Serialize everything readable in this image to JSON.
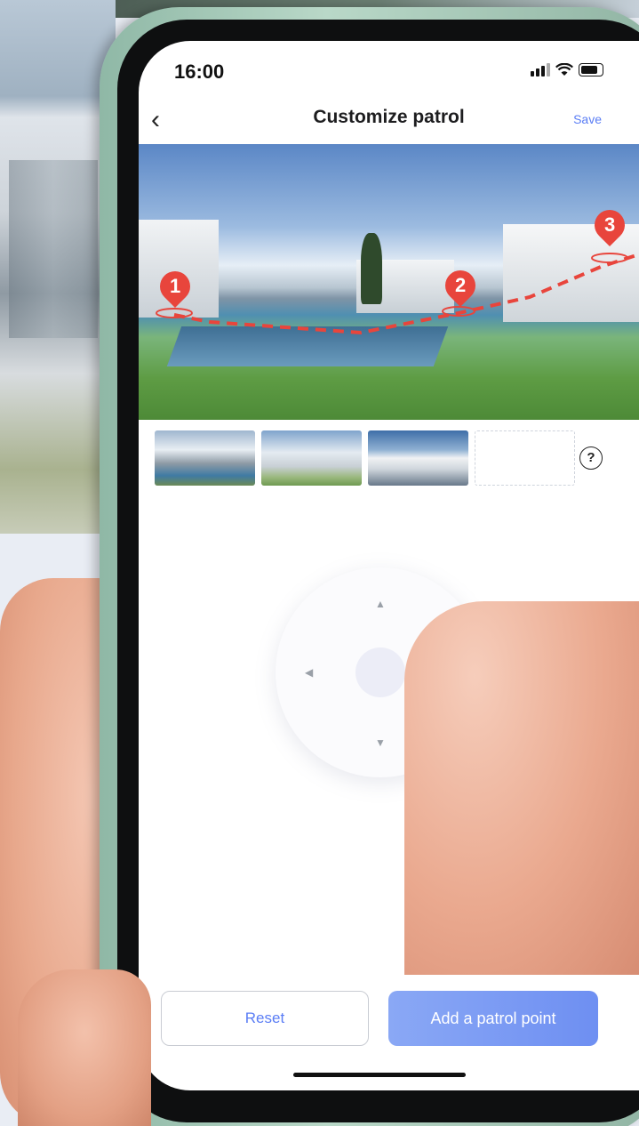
{
  "status_bar": {
    "time": "16:00"
  },
  "nav": {
    "back_icon": "chevron-left-icon",
    "title": "Customize patrol",
    "save_label": "Save"
  },
  "preview": {
    "patrol_points": [
      {
        "label": "1"
      },
      {
        "label": "2"
      },
      {
        "label": "3"
      }
    ],
    "path_color": "#e8453c"
  },
  "thumbnails": {
    "items": [
      "patrol-point-1",
      "patrol-point-2",
      "patrol-point-3",
      "empty-slot"
    ],
    "help_icon": "question-circle-icon",
    "help_glyph": "?"
  },
  "joystick": {
    "up_glyph": "▲",
    "down_glyph": "▼",
    "left_glyph": "◀"
  },
  "actions": {
    "reset_label": "Reset",
    "add_label": "Add a patrol point",
    "accent": "#5b7ef5"
  }
}
